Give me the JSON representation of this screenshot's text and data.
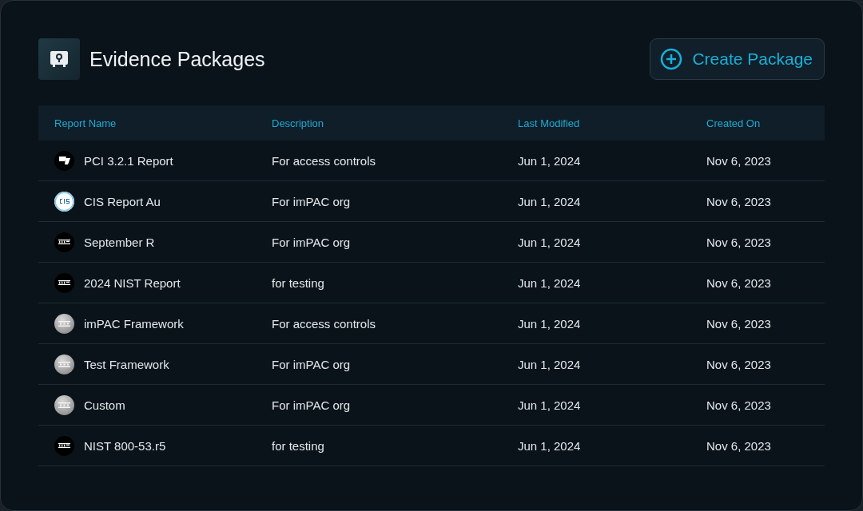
{
  "title": "Evidence Packages",
  "create_button": {
    "label": "Create Package"
  },
  "table": {
    "columns": [
      "Report Name",
      "Description",
      "Last Modified",
      "Created On"
    ],
    "rows": [
      {
        "logo": {
          "kind": "pci"
        },
        "name": "PCI 3.2.1 Report",
        "description": "For access controls",
        "last_modified": "Jun 1, 2024",
        "created_on": "Nov 6, 2023"
      },
      {
        "logo": {
          "kind": "light"
        },
        "name": "CIS Report Au",
        "description": "For imPAC org",
        "last_modified": "Jun 1, 2024",
        "created_on": "Nov 6, 2023"
      },
      {
        "logo": {
          "kind": "dark"
        },
        "name": "September R",
        "description": "For imPAC org",
        "last_modified": "Jun 1, 2024",
        "created_on": "Nov 6, 2023"
      },
      {
        "logo": {
          "kind": "dark"
        },
        "name": "2024 NIST Report",
        "description": "for testing",
        "last_modified": "Jun 1, 2024",
        "created_on": "Nov 6, 2023"
      },
      {
        "logo": {
          "kind": "metal"
        },
        "name": "imPAC Framework",
        "description": "For access controls",
        "last_modified": "Jun 1, 2024",
        "created_on": "Nov 6, 2023"
      },
      {
        "logo": {
          "kind": "metal"
        },
        "name": "Test Framework",
        "description": "For imPAC org",
        "last_modified": "Jun 1, 2024",
        "created_on": "Nov 6, 2023"
      },
      {
        "logo": {
          "kind": "metal"
        },
        "name": "Custom",
        "description": "For imPAC org",
        "last_modified": "Jun 1, 2024",
        "created_on": "Nov 6, 2023"
      },
      {
        "logo": {
          "kind": "dark"
        },
        "name": "NIST 800-53.r5",
        "description": "for testing",
        "last_modified": "Jun 1, 2024",
        "created_on": "Nov 6, 2023"
      }
    ]
  }
}
